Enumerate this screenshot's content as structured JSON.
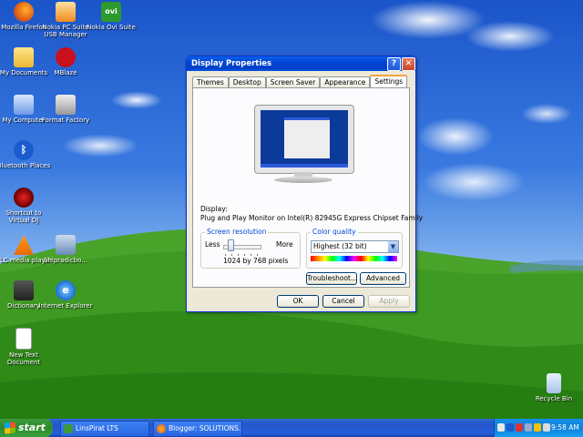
{
  "desktop": {
    "icons": [
      {
        "label": "Mozilla Firefox"
      },
      {
        "label": "Nokia PC Suite USB Manager"
      },
      {
        "label": "Nokia Ovi Suite"
      },
      {
        "label": "My Documents"
      },
      {
        "label": "MBlaze"
      },
      {
        "label": "My Computer"
      },
      {
        "label": "Format Factory"
      },
      {
        "label": "Bluetooth Places"
      },
      {
        "label": "Shortcut to Virtual DJ"
      },
      {
        "label": "VLC media player"
      },
      {
        "label": "Shipradicbo..."
      },
      {
        "label": "Dictionary"
      },
      {
        "label": "Internet Explorer"
      },
      {
        "label": "New Text Document"
      },
      {
        "label": "Recycle Bin"
      }
    ]
  },
  "window": {
    "title": "Display Properties",
    "help_glyph": "?",
    "close_glyph": "✕",
    "tabs": [
      "Themes",
      "Desktop",
      "Screen Saver",
      "Appearance",
      "Settings"
    ],
    "active_tab": "Settings",
    "display_label": "Display:",
    "display_value": "Plug and Play Monitor on Intel(R) 82945G Express Chipset Family",
    "resolution": {
      "title": "Screen resolution",
      "less": "Less",
      "more": "More",
      "value": "1024 by 768 pixels"
    },
    "color": {
      "title": "Color quality",
      "selected": "Highest (32 bit)",
      "arrow": "▼"
    },
    "buttons": {
      "troubleshoot": "Troubleshoot...",
      "advanced": "Advanced",
      "ok": "OK",
      "cancel": "Cancel",
      "apply": "Apply"
    }
  },
  "taskbar": {
    "start_label": "start",
    "tasks": [
      {
        "label": "LinsPirat LTS"
      },
      {
        "label": "Blogger: SOLUTIONS...."
      }
    ],
    "clock": "9:58 AM"
  },
  "colors": {
    "title_blue": "#0046d5",
    "taskbar_blue": "#245edb",
    "start_green": "#2d8a2d",
    "window_face": "#ece9d8"
  }
}
